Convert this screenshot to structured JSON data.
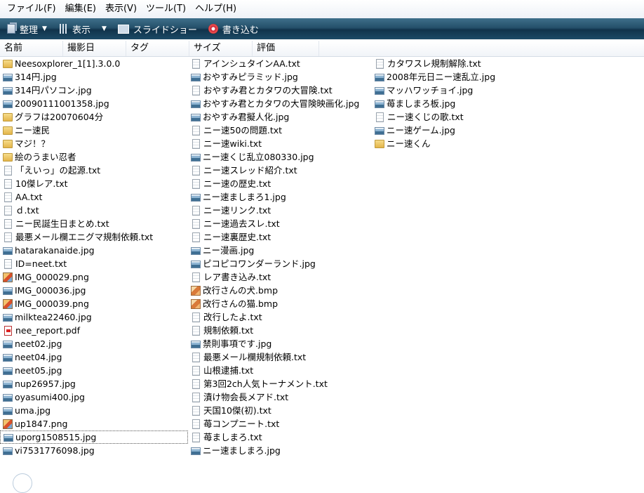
{
  "menu": [
    "ファイル(F)",
    "編集(E)",
    "表示(V)",
    "ツール(T)",
    "ヘルプ(H)"
  ],
  "toolbar": {
    "organize": "整理",
    "views": "表示",
    "slideshow": "スライドショー",
    "burn": "書き込む"
  },
  "columns": [
    "名前",
    "撮影日",
    "タグ",
    "サイズ",
    "評価"
  ],
  "files": {
    "col1": [
      {
        "name": "Neesoxplorer_1[1].3.0.0",
        "type": "folder"
      },
      {
        "name": "314円.jpg",
        "type": "jpg"
      },
      {
        "name": "314円パソコン.jpg",
        "type": "jpg"
      },
      {
        "name": "20090111001358.jpg",
        "type": "jpg"
      },
      {
        "name": "グラフは20070604分",
        "type": "folder"
      },
      {
        "name": "ニー速民",
        "type": "folder"
      },
      {
        "name": "マジ！？",
        "type": "folder"
      },
      {
        "name": "絵のうまい忍者",
        "type": "folder"
      },
      {
        "name": "「えいっ」の起源.txt",
        "type": "txt"
      },
      {
        "name": "10傑レア.txt",
        "type": "txt"
      },
      {
        "name": "AA.txt",
        "type": "txt"
      },
      {
        "name": "ｄ.txt",
        "type": "txt"
      },
      {
        "name": "ニー民誕生日まとめ.txt",
        "type": "txt"
      },
      {
        "name": "最悪メール欄エニグマ規制依頼.txt",
        "type": "txt"
      },
      {
        "name": "hatarakanaide.jpg",
        "type": "jpg"
      },
      {
        "name": "ID=neet.txt",
        "type": "txt"
      },
      {
        "name": "IMG_000029.png",
        "type": "png"
      },
      {
        "name": "IMG_000036.jpg",
        "type": "jpg"
      },
      {
        "name": "IMG_000039.png",
        "type": "png"
      },
      {
        "name": "milktea22460.jpg",
        "type": "jpg"
      },
      {
        "name": "nee_report.pdf",
        "type": "pdf"
      },
      {
        "name": "neet02.jpg",
        "type": "jpg"
      },
      {
        "name": "neet04.jpg",
        "type": "jpg"
      },
      {
        "name": "neet05.jpg",
        "type": "jpg"
      },
      {
        "name": "nup26957.jpg",
        "type": "jpg"
      },
      {
        "name": "oyasumi400.jpg",
        "type": "jpg"
      },
      {
        "name": "uma.jpg",
        "type": "jpg"
      },
      {
        "name": "up1847.png",
        "type": "png"
      },
      {
        "name": "uporg1508515.jpg",
        "type": "jpg",
        "focused": true
      },
      {
        "name": "vi7531776098.jpg",
        "type": "jpg"
      }
    ],
    "col2": [
      {
        "name": "アインシュタインAA.txt",
        "type": "txt"
      },
      {
        "name": "おやすみピラミッド.jpg",
        "type": "jpg"
      },
      {
        "name": "おやすみ君とカタワの大冒険.txt",
        "type": "txt"
      },
      {
        "name": "おやすみ君とカタワの大冒険映画化.jpg",
        "type": "jpg"
      },
      {
        "name": "おやすみ君擬人化.jpg",
        "type": "jpg"
      },
      {
        "name": "ニー速50の問題.txt",
        "type": "txt"
      },
      {
        "name": "ニー速wiki.txt",
        "type": "txt"
      },
      {
        "name": "ニー速くじ乱立080330.jpg",
        "type": "jpg"
      },
      {
        "name": "ニー速スレッド紹介.txt",
        "type": "txt"
      },
      {
        "name": "ニー速の歴史.txt",
        "type": "txt"
      },
      {
        "name": "ニー速ましまろ1.jpg",
        "type": "jpg"
      },
      {
        "name": "ニー速リンク.txt",
        "type": "txt"
      },
      {
        "name": "ニー速過去スレ.txt",
        "type": "txt"
      },
      {
        "name": "ニー速裏歴史.txt",
        "type": "txt"
      },
      {
        "name": "ニー漫画.jpg",
        "type": "jpg"
      },
      {
        "name": "ピコピコワンダーランド.jpg",
        "type": "jpg"
      },
      {
        "name": "レア書き込み.txt",
        "type": "txt"
      },
      {
        "name": "改行さんの犬.bmp",
        "type": "bmp"
      },
      {
        "name": "改行さんの猫.bmp",
        "type": "bmp"
      },
      {
        "name": "改行したよ.txt",
        "type": "txt"
      },
      {
        "name": "規制依頼.txt",
        "type": "txt"
      },
      {
        "name": "禁則事項です.jpg",
        "type": "jpg"
      },
      {
        "name": "最悪メール欄規制依頼.txt",
        "type": "txt"
      },
      {
        "name": "山根逮捕.txt",
        "type": "txt"
      },
      {
        "name": "第3回2ch人気トーナメント.txt",
        "type": "txt"
      },
      {
        "name": "漬け物会長メアド.txt",
        "type": "txt"
      },
      {
        "name": "天国10傑(初).txt",
        "type": "txt"
      },
      {
        "name": "苺コンプニート.txt",
        "type": "txt"
      },
      {
        "name": "苺ましまろ.txt",
        "type": "txt"
      },
      {
        "name": "ニー速ましまろ.jpg",
        "type": "jpg"
      }
    ],
    "col3": [
      {
        "name": "カタワスレ規制解除.txt",
        "type": "txt"
      },
      {
        "name": "2008年元日ニー速乱立.jpg",
        "type": "jpg"
      },
      {
        "name": "マッハワッチョイ.jpg",
        "type": "jpg"
      },
      {
        "name": "苺ましまろ板.jpg",
        "type": "jpg"
      },
      {
        "name": "ニー速くじの歌.txt",
        "type": "txt"
      },
      {
        "name": "ニー速ゲーム.jpg",
        "type": "jpg"
      },
      {
        "name": "ニー速くん",
        "type": "folder"
      }
    ]
  }
}
